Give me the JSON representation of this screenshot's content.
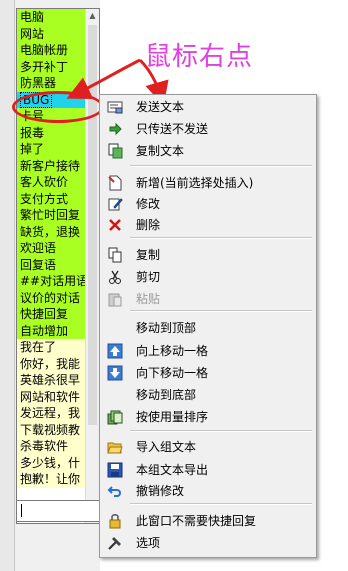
{
  "list": {
    "items": [
      {
        "text": "电脑",
        "style": "green"
      },
      {
        "text": "网站",
        "style": "green"
      },
      {
        "text": "电脑帐册",
        "style": "green"
      },
      {
        "text": "多开补丁",
        "style": "green"
      },
      {
        "text": "防黑器",
        "style": "green"
      },
      {
        "text": "BUG",
        "style": "selected"
      },
      {
        "text": "卡号",
        "style": "green"
      },
      {
        "text": "报毒",
        "style": "green"
      },
      {
        "text": "掉了",
        "style": "green"
      },
      {
        "text": "新客户接待",
        "style": "green"
      },
      {
        "text": "客人砍价",
        "style": "green"
      },
      {
        "text": "支付方式",
        "style": "green"
      },
      {
        "text": "繁忙时回复",
        "style": "green"
      },
      {
        "text": "缺货，退换",
        "style": "green"
      },
      {
        "text": "欢迎语",
        "style": "green"
      },
      {
        "text": "回复语",
        "style": "green"
      },
      {
        "text": "##对话用语",
        "style": "green"
      },
      {
        "text": "议价的对话",
        "style": "green"
      },
      {
        "text": "快捷回复",
        "style": "green"
      },
      {
        "text": "自动增加",
        "style": "green"
      },
      {
        "text": "我在了",
        "style": "yellow"
      },
      {
        "text": "你好，我能",
        "style": "yellow"
      },
      {
        "text": "英雄杀很早",
        "style": "yellow"
      },
      {
        "text": "网站和软件",
        "style": "yellow"
      },
      {
        "text": "发远程，我",
        "style": "yellow"
      },
      {
        "text": "下载视频教",
        "style": "yellow"
      },
      {
        "text": "杀毒软件",
        "style": "yellow"
      },
      {
        "text": "多少钱，什",
        "style": "yellow"
      },
      {
        "text": "抱歉！让你",
        "style": "yellow"
      }
    ],
    "input_value": ""
  },
  "annotation": {
    "text": "鼠标右点",
    "color": "#e040e0"
  },
  "menu": {
    "items": [
      {
        "label": "发送文本",
        "icon": "send-text-icon",
        "enabled": true
      },
      {
        "label": "只传送不发送",
        "icon": "arrow-right-icon",
        "enabled": true
      },
      {
        "label": "复制文本",
        "icon": "copy-text-icon",
        "enabled": true
      },
      {
        "label": "新增(当前选择处插入)",
        "icon": "new-document-icon",
        "enabled": true
      },
      {
        "label": "修改",
        "icon": "edit-icon",
        "enabled": true
      },
      {
        "label": "删除",
        "icon": "delete-x-icon",
        "enabled": true
      },
      {
        "label": "复制",
        "icon": "copy-icon",
        "enabled": true
      },
      {
        "label": "剪切",
        "icon": "scissors-icon",
        "enabled": true
      },
      {
        "label": "粘贴",
        "icon": "paste-icon",
        "enabled": false
      },
      {
        "label": "移动到顶部",
        "icon": "",
        "enabled": true
      },
      {
        "label": "向上移动一格",
        "icon": "move-up-icon",
        "enabled": true
      },
      {
        "label": "向下移动一格",
        "icon": "move-down-icon",
        "enabled": true
      },
      {
        "label": "移动到底部",
        "icon": "",
        "enabled": true
      },
      {
        "label": "按使用量排序",
        "icon": "sort-icon",
        "enabled": true
      },
      {
        "label": "导入组文本",
        "icon": "open-folder-icon",
        "enabled": true
      },
      {
        "label": "本组文本导出",
        "icon": "save-disk-icon",
        "enabled": true
      },
      {
        "label": "撤销修改",
        "icon": "undo-icon",
        "enabled": true
      },
      {
        "label": "此窗口不需要快捷回复",
        "icon": "lock-icon",
        "enabled": true
      },
      {
        "label": "选项",
        "icon": "hammer-icon",
        "enabled": true
      }
    ]
  },
  "colors": {
    "green_item": "#aaff22",
    "yellow_item": "#ffffcc",
    "selected_item": "#1fd3ef",
    "annotation_red": "#e02020"
  }
}
